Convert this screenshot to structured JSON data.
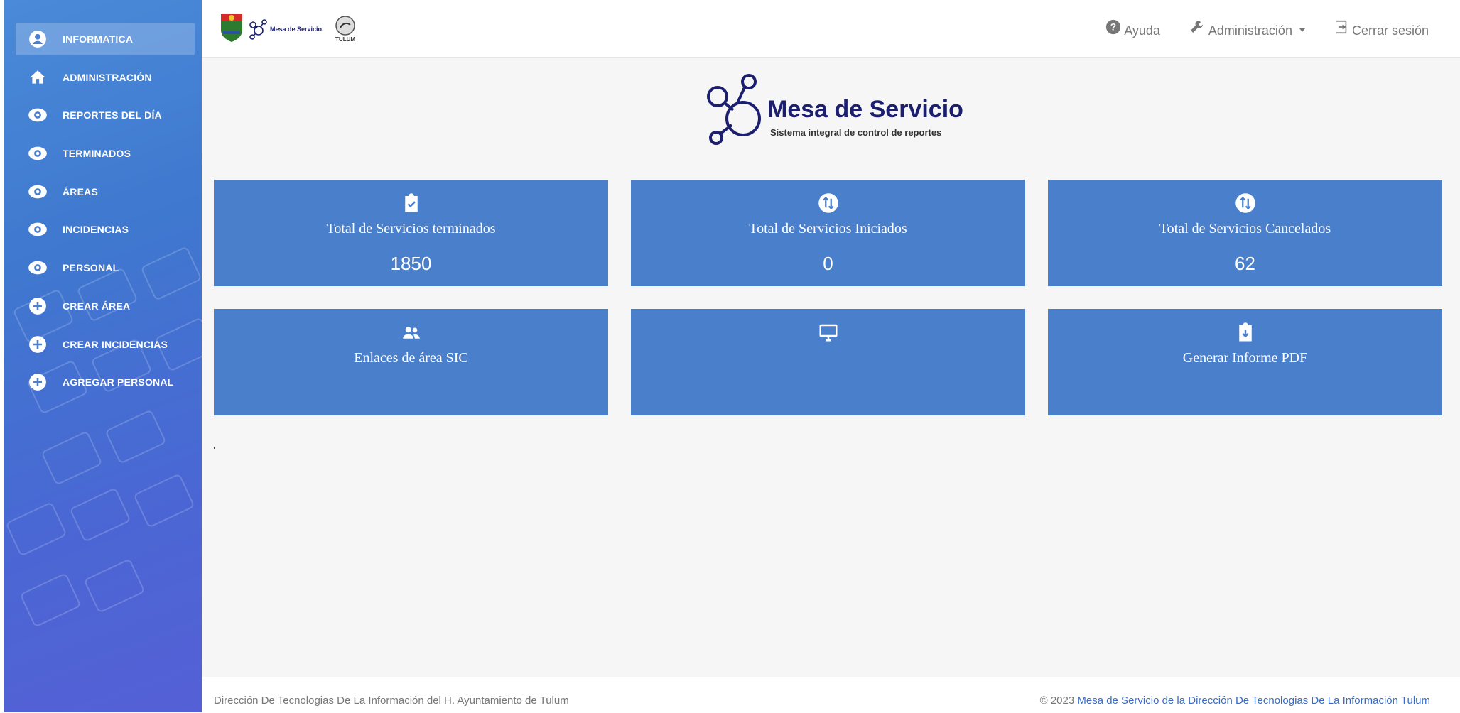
{
  "sidebar": {
    "items": [
      {
        "label": "INFORMATICA",
        "icon": "user-circle-icon",
        "active": true
      },
      {
        "label": "ADMINISTRACIÓN",
        "icon": "home-icon"
      },
      {
        "label": "REPORTES DEL DÍA",
        "icon": "eye-icon"
      },
      {
        "label": "TERMINADOS",
        "icon": "eye-icon"
      },
      {
        "label": "ÁREAS",
        "icon": "eye-icon"
      },
      {
        "label": "INCIDENCIAS",
        "icon": "eye-icon"
      },
      {
        "label": "PERSONAL",
        "icon": "eye-icon"
      },
      {
        "label": "CREAR ÁREA",
        "icon": "plus-circle-icon"
      },
      {
        "label": "CREAR INCIDENCIAS",
        "icon": "plus-circle-icon"
      },
      {
        "label": "AGREGAR PERSONAL",
        "icon": "plus-circle-icon"
      }
    ]
  },
  "header": {
    "logo_text": "Mesa de Servicio",
    "city_logo_text": "TULUM",
    "help_label": "Ayuda",
    "admin_label": "Administración",
    "logout_label": "Cerrar sesión"
  },
  "brand": {
    "title": "Mesa de Servicio",
    "subtitle": "Sistema integral de control de reportes"
  },
  "cards": [
    {
      "title": "Total de Servicios terminados",
      "value": "1850",
      "icon": "clipboard-check-icon"
    },
    {
      "title": "Total de Servicios Iniciados",
      "value": "0",
      "icon": "swap-vertical-icon"
    },
    {
      "title": "Total de Servicios Cancelados",
      "value": "62",
      "icon": "swap-vertical-icon"
    },
    {
      "title": "Enlaces de área SIC",
      "value": "",
      "icon": "users-icon"
    },
    {
      "title": "",
      "value": "",
      "icon": "monitor-icon"
    },
    {
      "title": "Generar Informe PDF",
      "value": "",
      "icon": "clipboard-download-icon"
    }
  ],
  "footer": {
    "left": "Dirección De Tecnologias De La Información del H. Ayuntamiento de Tulum",
    "copyright": "© 2023",
    "right_link": "Mesa de Servicio de la Dirección De Tecnologias De La Información Tulum"
  },
  "colors": {
    "sidebar": "#4a7fd0",
    "card": "#4a7fcc",
    "brand_dark": "#1b1f6e",
    "link": "#3a6cc4"
  }
}
